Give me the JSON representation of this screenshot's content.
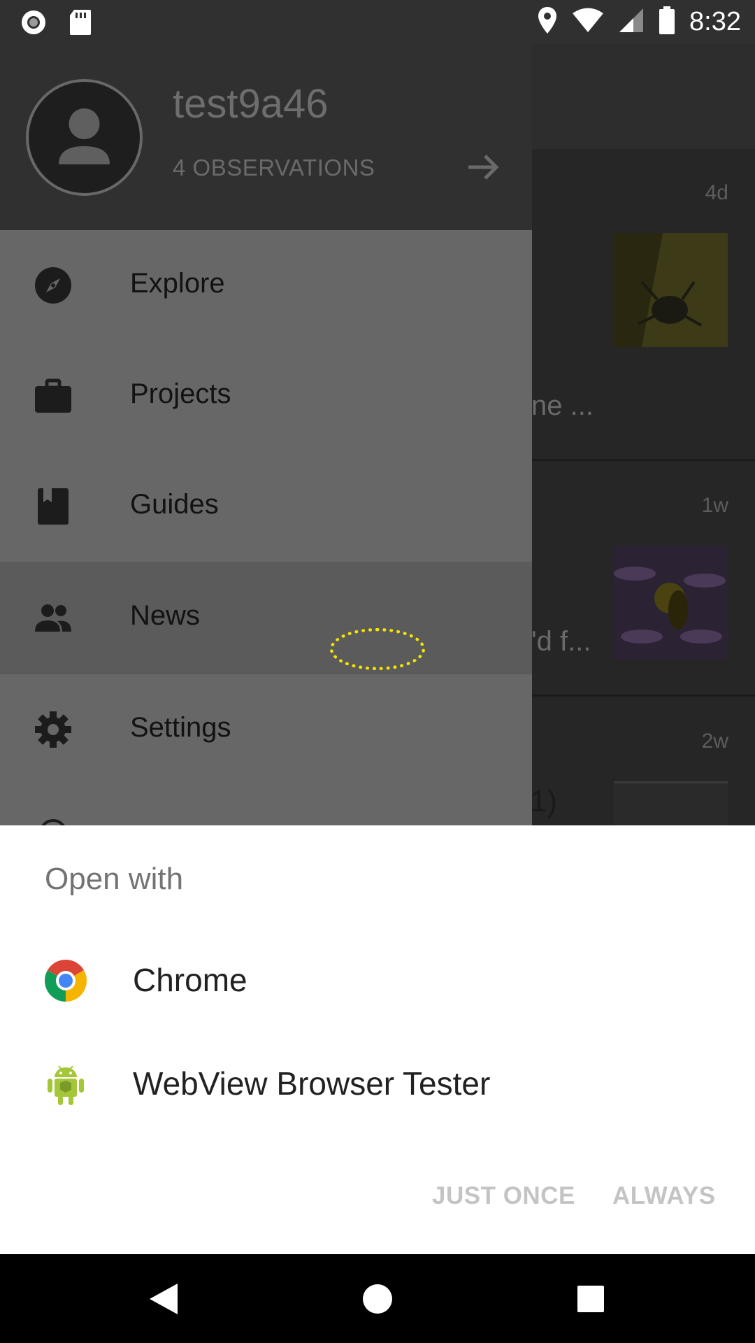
{
  "status_bar": {
    "time": "8:32",
    "icons": [
      "record-icon",
      "sd-card-icon",
      "location-icon",
      "wifi-icon",
      "signal-icon",
      "battery-icon"
    ]
  },
  "background_feed": {
    "items": [
      {
        "time": "4d",
        "snippet": "ne ..."
      },
      {
        "time": "1w",
        "snippet": "'d f..."
      },
      {
        "time": "2w",
        "snippet": "1)"
      }
    ]
  },
  "drawer": {
    "username": "test9a46",
    "observations": "4 OBSERVATIONS",
    "items": [
      {
        "label": "Explore",
        "icon": "compass-icon"
      },
      {
        "label": "Projects",
        "icon": "briefcase-icon"
      },
      {
        "label": "Guides",
        "icon": "book-icon"
      },
      {
        "label": "News",
        "icon": "people-icon"
      },
      {
        "label": "Settings",
        "icon": "gear-icon"
      }
    ],
    "active_item": "News"
  },
  "open_with_sheet": {
    "title": "Open with",
    "apps": [
      {
        "label": "Chrome",
        "icon": "chrome-icon"
      },
      {
        "label": "WebView Browser Tester",
        "icon": "android-icon"
      }
    ],
    "just_once_label": "JUST ONCE",
    "always_label": "ALWAYS"
  },
  "nav_bar": {
    "icons": [
      "back-icon",
      "home-icon",
      "recents-icon"
    ]
  },
  "colors": {
    "drawer_bg": "#676767",
    "drawer_header_bg": "#303030",
    "sheet_bg": "#ffffff",
    "disabled_button": "#c4c4c4",
    "tap_indicator": "#f5e600"
  }
}
